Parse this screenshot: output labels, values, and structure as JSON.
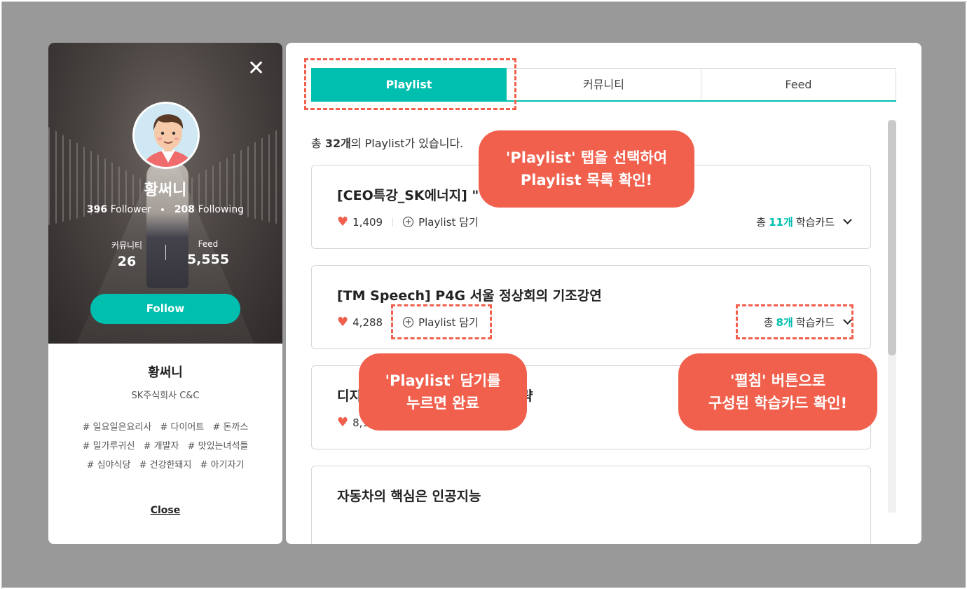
{
  "profile": {
    "close_icon": "close-icon",
    "name": "황써니",
    "follower_count": "396",
    "follower_label": "Follower",
    "following_count": "208",
    "following_label": "Following",
    "stats": [
      {
        "label": "커뮤니티",
        "value": "26"
      },
      {
        "label": "Feed",
        "value": "5,555"
      }
    ],
    "follow_button": "Follow",
    "display_name": "황써니",
    "company": "SK주식회사 C&C",
    "tags": [
      "# 일요일은요리사",
      "# 다이어트",
      "# 돈까스",
      "# 밀가루귀신",
      "# 개발자",
      "# 맛있는녀석들",
      "# 심야식당",
      "# 건강한돼지",
      "# 아기자기"
    ],
    "close_link": "Close"
  },
  "tabs": [
    {
      "label": "Playlist",
      "active": true
    },
    {
      "label": "커뮤니티",
      "active": false
    },
    {
      "label": "Feed",
      "active": false
    }
  ],
  "summary": {
    "prefix": "총 ",
    "count": "32개",
    "suffix": "의 Playlist가 있습니다."
  },
  "playlists": [
    {
      "title": "[CEO특강_SK에너지] \"",
      "likes": "1,409",
      "add_label": "Playlist 담기",
      "total_prefix": "총",
      "card_count": "11개",
      "card_label": "학습카드"
    },
    {
      "title": "[TM Speech] P4G 서울 정상회의 기조강연",
      "likes": "4,288",
      "add_label": "Playlist 담기",
      "total_prefix": "총",
      "card_count": "8개",
      "card_label": "학습카드"
    },
    {
      "title": "디지",
      "title_tail": "략",
      "likes": "8,9"
    },
    {
      "title": "자동차의 핵심은 인공지능"
    }
  ],
  "annotations": {
    "tab_note": [
      "'Playlist' 탭을 선택하여",
      "Playlist 목록 확인!"
    ],
    "add_note": [
      "'Playlist' 담기를",
      "누르면 완료"
    ],
    "expand_note": [
      "'펼침' 버튼으로",
      "구성된 학습카드 확인!"
    ]
  },
  "colors": {
    "accent": "#00bfae",
    "annotation": "#f0604d",
    "heart": "#f0604d",
    "backdrop": "#999999"
  }
}
